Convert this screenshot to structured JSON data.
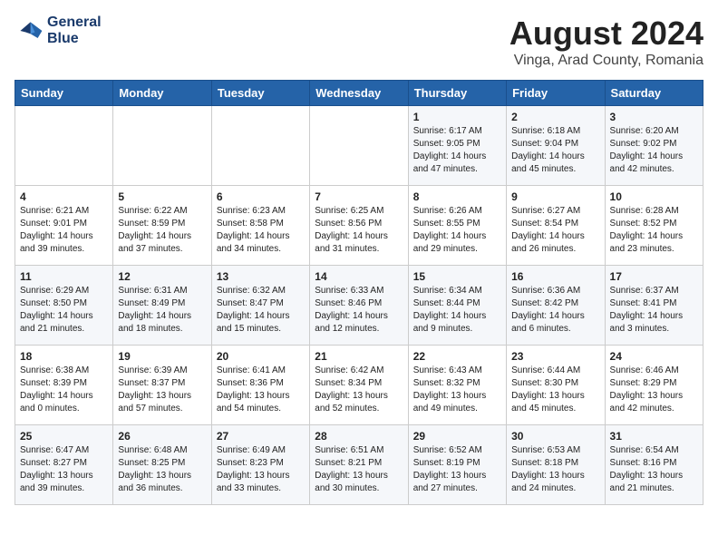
{
  "logo": {
    "line1": "General",
    "line2": "Blue"
  },
  "title": "August 2024",
  "subtitle": "Vinga, Arad County, Romania",
  "weekdays": [
    "Sunday",
    "Monday",
    "Tuesday",
    "Wednesday",
    "Thursday",
    "Friday",
    "Saturday"
  ],
  "weeks": [
    [
      {
        "day": "",
        "info": ""
      },
      {
        "day": "",
        "info": ""
      },
      {
        "day": "",
        "info": ""
      },
      {
        "day": "",
        "info": ""
      },
      {
        "day": "1",
        "info": "Sunrise: 6:17 AM\nSunset: 9:05 PM\nDaylight: 14 hours\nand 47 minutes."
      },
      {
        "day": "2",
        "info": "Sunrise: 6:18 AM\nSunset: 9:04 PM\nDaylight: 14 hours\nand 45 minutes."
      },
      {
        "day": "3",
        "info": "Sunrise: 6:20 AM\nSunset: 9:02 PM\nDaylight: 14 hours\nand 42 minutes."
      }
    ],
    [
      {
        "day": "4",
        "info": "Sunrise: 6:21 AM\nSunset: 9:01 PM\nDaylight: 14 hours\nand 39 minutes."
      },
      {
        "day": "5",
        "info": "Sunrise: 6:22 AM\nSunset: 8:59 PM\nDaylight: 14 hours\nand 37 minutes."
      },
      {
        "day": "6",
        "info": "Sunrise: 6:23 AM\nSunset: 8:58 PM\nDaylight: 14 hours\nand 34 minutes."
      },
      {
        "day": "7",
        "info": "Sunrise: 6:25 AM\nSunset: 8:56 PM\nDaylight: 14 hours\nand 31 minutes."
      },
      {
        "day": "8",
        "info": "Sunrise: 6:26 AM\nSunset: 8:55 PM\nDaylight: 14 hours\nand 29 minutes."
      },
      {
        "day": "9",
        "info": "Sunrise: 6:27 AM\nSunset: 8:54 PM\nDaylight: 14 hours\nand 26 minutes."
      },
      {
        "day": "10",
        "info": "Sunrise: 6:28 AM\nSunset: 8:52 PM\nDaylight: 14 hours\nand 23 minutes."
      }
    ],
    [
      {
        "day": "11",
        "info": "Sunrise: 6:29 AM\nSunset: 8:50 PM\nDaylight: 14 hours\nand 21 minutes."
      },
      {
        "day": "12",
        "info": "Sunrise: 6:31 AM\nSunset: 8:49 PM\nDaylight: 14 hours\nand 18 minutes."
      },
      {
        "day": "13",
        "info": "Sunrise: 6:32 AM\nSunset: 8:47 PM\nDaylight: 14 hours\nand 15 minutes."
      },
      {
        "day": "14",
        "info": "Sunrise: 6:33 AM\nSunset: 8:46 PM\nDaylight: 14 hours\nand 12 minutes."
      },
      {
        "day": "15",
        "info": "Sunrise: 6:34 AM\nSunset: 8:44 PM\nDaylight: 14 hours\nand 9 minutes."
      },
      {
        "day": "16",
        "info": "Sunrise: 6:36 AM\nSunset: 8:42 PM\nDaylight: 14 hours\nand 6 minutes."
      },
      {
        "day": "17",
        "info": "Sunrise: 6:37 AM\nSunset: 8:41 PM\nDaylight: 14 hours\nand 3 minutes."
      }
    ],
    [
      {
        "day": "18",
        "info": "Sunrise: 6:38 AM\nSunset: 8:39 PM\nDaylight: 14 hours\nand 0 minutes."
      },
      {
        "day": "19",
        "info": "Sunrise: 6:39 AM\nSunset: 8:37 PM\nDaylight: 13 hours\nand 57 minutes."
      },
      {
        "day": "20",
        "info": "Sunrise: 6:41 AM\nSunset: 8:36 PM\nDaylight: 13 hours\nand 54 minutes."
      },
      {
        "day": "21",
        "info": "Sunrise: 6:42 AM\nSunset: 8:34 PM\nDaylight: 13 hours\nand 52 minutes."
      },
      {
        "day": "22",
        "info": "Sunrise: 6:43 AM\nSunset: 8:32 PM\nDaylight: 13 hours\nand 49 minutes."
      },
      {
        "day": "23",
        "info": "Sunrise: 6:44 AM\nSunset: 8:30 PM\nDaylight: 13 hours\nand 45 minutes."
      },
      {
        "day": "24",
        "info": "Sunrise: 6:46 AM\nSunset: 8:29 PM\nDaylight: 13 hours\nand 42 minutes."
      }
    ],
    [
      {
        "day": "25",
        "info": "Sunrise: 6:47 AM\nSunset: 8:27 PM\nDaylight: 13 hours\nand 39 minutes."
      },
      {
        "day": "26",
        "info": "Sunrise: 6:48 AM\nSunset: 8:25 PM\nDaylight: 13 hours\nand 36 minutes."
      },
      {
        "day": "27",
        "info": "Sunrise: 6:49 AM\nSunset: 8:23 PM\nDaylight: 13 hours\nand 33 minutes."
      },
      {
        "day": "28",
        "info": "Sunrise: 6:51 AM\nSunset: 8:21 PM\nDaylight: 13 hours\nand 30 minutes."
      },
      {
        "day": "29",
        "info": "Sunrise: 6:52 AM\nSunset: 8:19 PM\nDaylight: 13 hours\nand 27 minutes."
      },
      {
        "day": "30",
        "info": "Sunrise: 6:53 AM\nSunset: 8:18 PM\nDaylight: 13 hours\nand 24 minutes."
      },
      {
        "day": "31",
        "info": "Sunrise: 6:54 AM\nSunset: 8:16 PM\nDaylight: 13 hours\nand 21 minutes."
      }
    ]
  ]
}
